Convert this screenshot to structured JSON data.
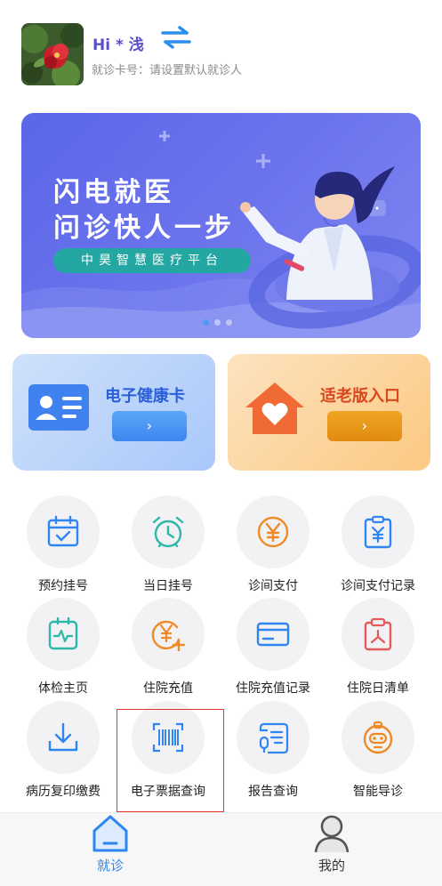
{
  "header": {
    "greeting": "Hi * 浅",
    "card_info": "就诊卡号：请设置默认就诊人",
    "avatar_icon": "avatar-flower-photo",
    "swap_icon": "swap-arrows-icon"
  },
  "banner": {
    "title_line1": "闪电就医",
    "title_line2": "问诊快人一步",
    "subtitle": "中昊智慧医疗平台",
    "active_slide": 1,
    "slide_count": 3
  },
  "cards": {
    "health": {
      "title": "电子健康卡",
      "button": "›",
      "icon": "id-card-icon"
    },
    "elder": {
      "title": "适老版入口",
      "button": "›",
      "icon": "house-heart-icon"
    }
  },
  "grid": [
    {
      "label": "预约挂号",
      "icon": "calendar-check-icon"
    },
    {
      "label": "当日挂号",
      "icon": "alarm-clock-icon"
    },
    {
      "label": "诊间支付",
      "icon": "yen-coin-icon"
    },
    {
      "label": "诊间支付记录",
      "icon": "yen-clipboard-icon"
    },
    {
      "label": "体检主页",
      "icon": "health-monitor-icon"
    },
    {
      "label": "住院充值",
      "icon": "yen-plus-icon"
    },
    {
      "label": "住院充值记录",
      "icon": "card-record-icon"
    },
    {
      "label": "住院日清单",
      "icon": "daily-list-icon"
    },
    {
      "label": "病历复印缴费",
      "icon": "download-tray-icon"
    },
    {
      "label": "电子票据查询",
      "icon": "barcode-scan-icon"
    },
    {
      "label": "报告查询",
      "icon": "report-scroll-icon"
    },
    {
      "label": "智能导诊",
      "icon": "robot-icon"
    }
  ],
  "tabs": [
    {
      "label": "就诊",
      "icon": "home-icon",
      "active": true
    },
    {
      "label": "我的",
      "icon": "user-icon",
      "active": false
    }
  ],
  "colors": {
    "accent": "#2f86f0",
    "greeting": "#5a4ec9",
    "highlight": "#e0382f"
  }
}
